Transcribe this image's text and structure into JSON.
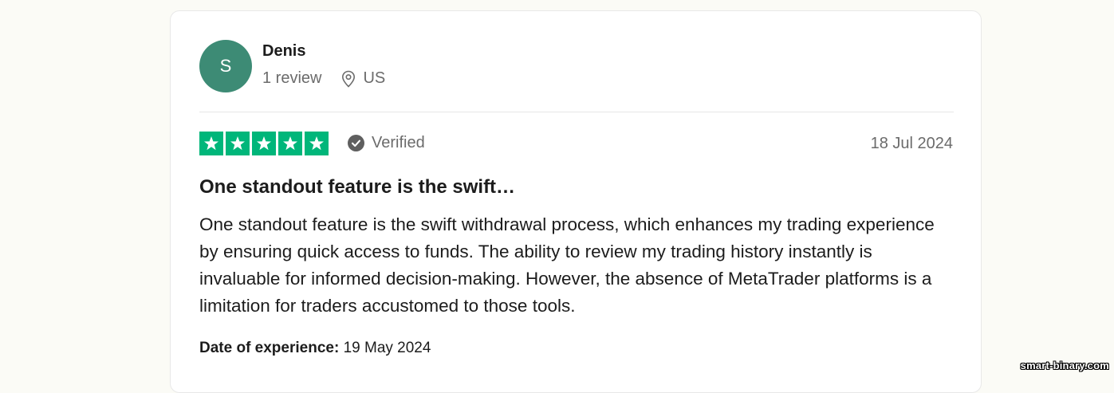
{
  "reviewer": {
    "initial": "S",
    "name": "Denis",
    "review_count": "1 review",
    "country": "US",
    "avatar_color": "#3d8b75"
  },
  "rating": {
    "stars": 5,
    "max": 5,
    "star_color": "#00b67a"
  },
  "verified_label": "Verified",
  "review_date": "18 Jul 2024",
  "review": {
    "title": "One standout feature is the swift…",
    "body": "One standout feature is the swift withdrawal process, which enhances my trading experience by ensuring quick access to funds. The ability to review my trading history instantly is invaluable for informed decision-making. However, the absence of MetaTrader platforms is a limitation for traders accustomed to those tools."
  },
  "experience": {
    "label": "Date of experience:",
    "date": "19 May 2024"
  },
  "watermark": "smart-binary.com",
  "icons": {
    "location": "map-pin-icon",
    "verified": "check-circle-icon",
    "star": "star-icon"
  }
}
